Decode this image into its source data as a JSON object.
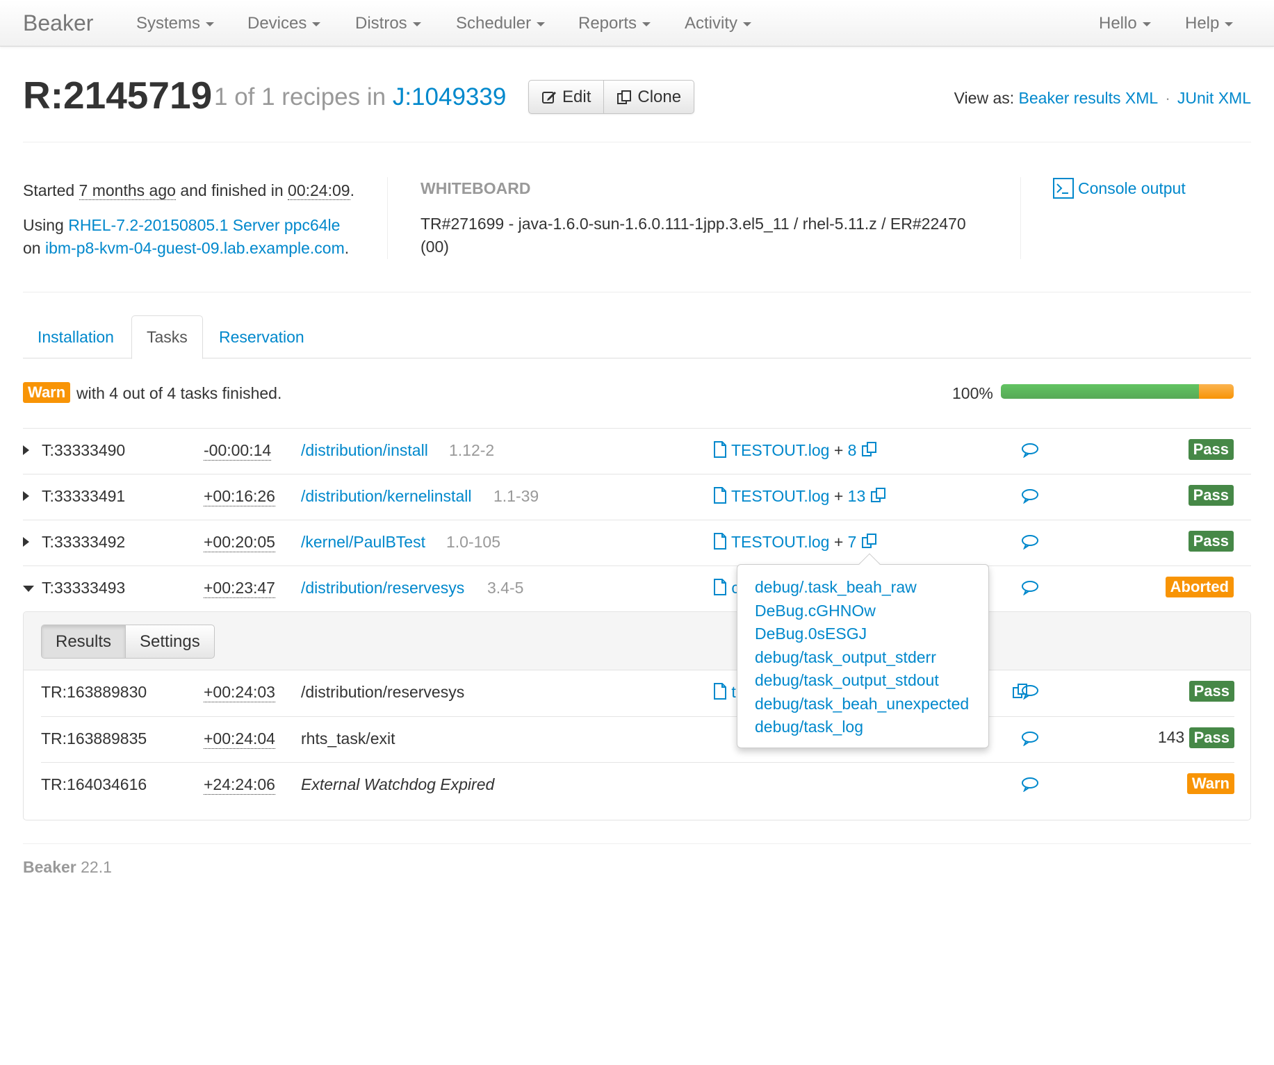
{
  "navbar": {
    "brand": "Beaker",
    "items": [
      "Systems",
      "Devices",
      "Distros",
      "Scheduler",
      "Reports",
      "Activity"
    ],
    "right_items": [
      "Hello",
      "Help"
    ]
  },
  "header": {
    "recipe_id": "R:2145719",
    "subtitle_prefix": "1 of 1 recipes in",
    "job_link": "J:1049339",
    "edit_label": "Edit",
    "clone_label": "Clone",
    "view_as_label": "View as:",
    "view_as_links": [
      "Beaker results XML",
      "JUnit XML"
    ]
  },
  "summary": {
    "started_prefix": "Started",
    "started_ago": "7 months ago",
    "finished_mid": "and finished in",
    "duration": "00:24:09",
    "using_prefix": "Using",
    "distro": "RHEL-7.2-20150805.1 Server ppc64le",
    "on_prefix": "on",
    "host": "ibm-p8-kvm-04-guest-09.lab.example.com",
    "whiteboard_label": "WHITEBOARD",
    "whiteboard_text": "TR#271699 - java-1.6.0-sun-1.6.0.111-1jpp.3.el5_11 / rhel-5.11.z / ER#22470 (00)",
    "console_label": "Console output"
  },
  "tabs": [
    "Installation",
    "Tasks",
    "Reservation"
  ],
  "status": {
    "result": "Warn",
    "text": "with 4 out of 4 tasks finished.",
    "percent": "100%",
    "pass_fraction": 0.85,
    "warn_fraction": 0.15
  },
  "tasks": [
    {
      "id": "T:33333490",
      "time": "-00:00:14",
      "name": "/distribution/install",
      "version": "1.12-2",
      "log": "TESTOUT.log",
      "plus": "+",
      "count": "8",
      "result": "Pass"
    },
    {
      "id": "T:33333491",
      "time": "+00:16:26",
      "name": "/distribution/kernelinstall",
      "version": "1.1-39",
      "log": "TESTOUT.log",
      "plus": "+",
      "count": "13",
      "result": "Pass"
    },
    {
      "id": "T:33333492",
      "time": "+00:20:05",
      "name": "/kernel/PaulBTest",
      "version": "1.0-105",
      "log": "TESTOUT.log",
      "plus": "+",
      "count": "7",
      "result": "Pass"
    },
    {
      "id": "T:33333493",
      "time": "+00:23:47",
      "name": "/distribution/reservesys",
      "version": "3.4-5",
      "log": "c",
      "result": "Aborted"
    }
  ],
  "results_panel": {
    "tabs": [
      "Results",
      "Settings"
    ],
    "rows": [
      {
        "id": "TR:163889830",
        "time": "+00:24:03",
        "name": "/distribution/reservesys",
        "log": "t",
        "score": "",
        "result": "Pass"
      },
      {
        "id": "TR:163889835",
        "time": "+00:24:04",
        "name": "rhts_task/exit",
        "score": "143",
        "result": "Pass"
      },
      {
        "id": "TR:164034616",
        "time": "+24:24:06",
        "name": "External Watchdog Expired",
        "score": "",
        "result": "Warn"
      }
    ]
  },
  "popover": {
    "items": [
      "debug/.task_beah_raw",
      "DeBug.cGHNOw",
      "DeBug.0sESGJ",
      "debug/task_output_stderr",
      "debug/task_output_stdout",
      "debug/task_beah_unexpected",
      "debug/task_log"
    ]
  },
  "footer": {
    "brand": "Beaker",
    "version": "22.1"
  },
  "colors": {
    "link": "#0088cc",
    "pass": "#468847",
    "warn": "#f89406"
  }
}
